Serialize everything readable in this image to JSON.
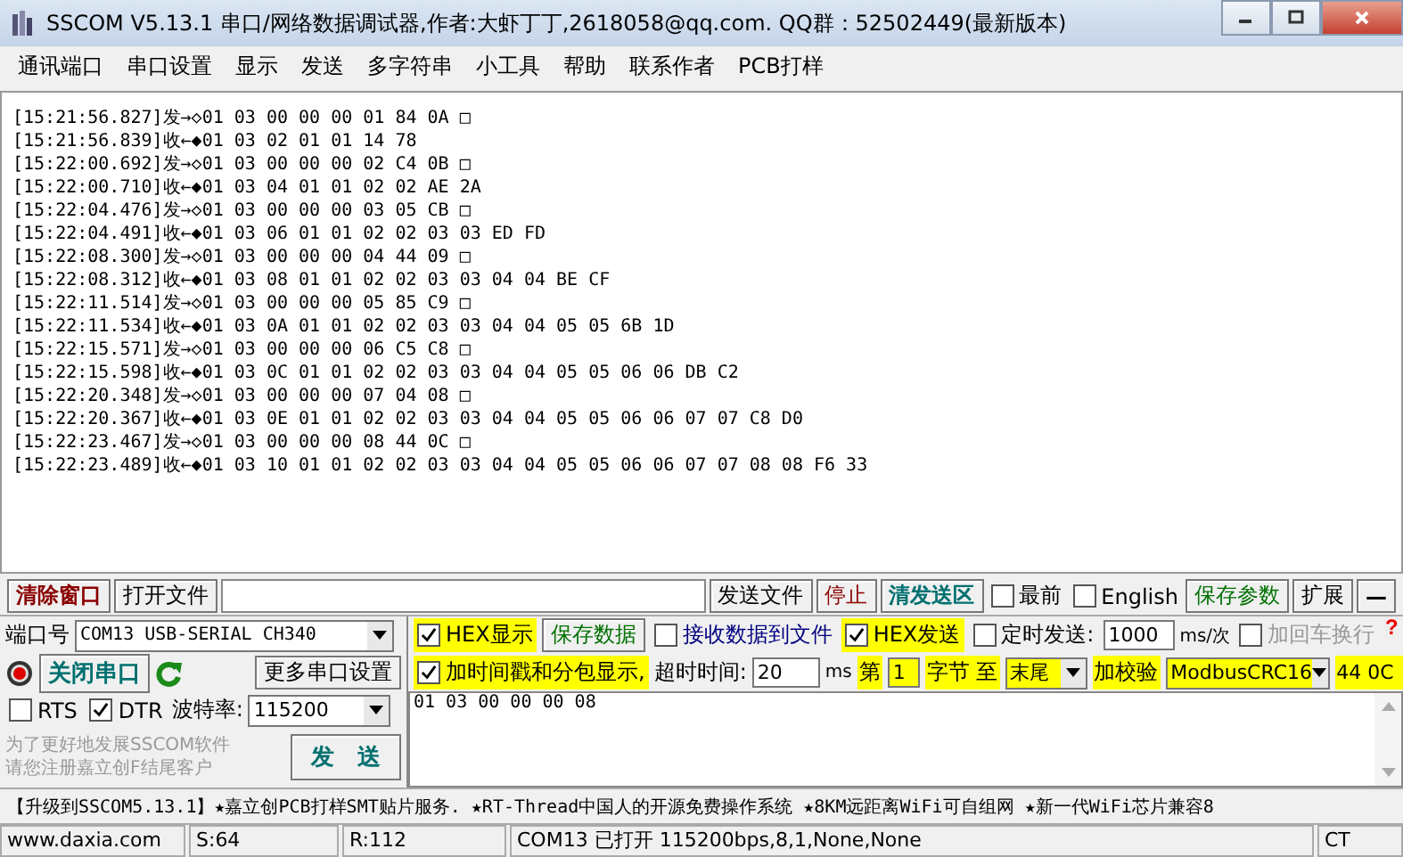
{
  "window": {
    "title": "SSCOM V5.13.1 串口/网络数据调试器,作者:大虾丁丁,2618058@qq.com. QQ群：52502449(最新版本)"
  },
  "menu": [
    "通讯端口",
    "串口设置",
    "显示",
    "发送",
    "多字符串",
    "小工具",
    "帮助",
    "联系作者",
    "PCB打样"
  ],
  "log": [
    "[15:21:56.827]发→◇01 03 00 00 00 01 84 0A □",
    "[15:21:56.839]收←◆01 03 02 01 01 14 78",
    "[15:22:00.692]发→◇01 03 00 00 00 02 C4 0B □",
    "[15:22:00.710]收←◆01 03 04 01 01 02 02 AE 2A",
    "[15:22:04.476]发→◇01 03 00 00 00 03 05 CB □",
    "[15:22:04.491]收←◆01 03 06 01 01 02 02 03 03 ED FD",
    "[15:22:08.300]发→◇01 03 00 00 00 04 44 09 □",
    "[15:22:08.312]收←◆01 03 08 01 01 02 02 03 03 04 04 BE CF",
    "[15:22:11.514]发→◇01 03 00 00 00 05 85 C9 □",
    "[15:22:11.534]收←◆01 03 0A 01 01 02 02 03 03 04 04 05 05 6B 1D",
    "[15:22:15.571]发→◇01 03 00 00 00 06 C5 C8 □",
    "[15:22:15.598]收←◆01 03 0C 01 01 02 02 03 03 04 04 05 05 06 06 DB C2",
    "[15:22:20.348]发→◇01 03 00 00 00 07 04 08 □",
    "[15:22:20.367]收←◆01 03 0E 01 01 02 02 03 03 04 04 05 05 06 06 07 07 C8 D0",
    "[15:22:23.467]发→◇01 03 00 00 00 08 44 0C □",
    "[15:22:23.489]收←◆01 03 10 01 01 02 02 03 03 04 04 05 05 06 06 07 07 08 08 F6 33"
  ],
  "toolbar": {
    "clear_button": "清除窗口",
    "open_file_button": "打开文件",
    "send_file_button": "发送文件",
    "stop_button": "停止",
    "clear_send_button": "清发送区",
    "topmost": {
      "label": "最前",
      "checked": false
    },
    "english": {
      "label": "English",
      "checked": false
    },
    "save_params_button": "保存参数",
    "expand_button": "扩展",
    "collapse_button": "—"
  },
  "port_panel": {
    "port_label": "端口号",
    "port_value": "COM13 USB-SERIAL CH340",
    "close_port_button": "关闭串口",
    "more_settings_button": "更多串口设置",
    "rts": {
      "label": "RTS",
      "checked": false
    },
    "dtr": {
      "label": "DTR",
      "checked": true
    },
    "baud_label": "波特率:",
    "baud_value": "115200",
    "promo_lines": [
      "为了更好地发展SSCOM软件",
      "请您注册嘉立创F结尾客户"
    ],
    "send_button": "发　送"
  },
  "options": {
    "hex_display": {
      "label": "HEX显示",
      "checked": true
    },
    "save_data_button": "保存数据",
    "recv_to_file": {
      "label": "接收数据到文件",
      "checked": false
    },
    "hex_send": {
      "label": "HEX发送",
      "checked": true
    },
    "timed_send": {
      "label": "定时发送:",
      "checked": false
    },
    "interval": "1000",
    "interval_unit": "ms/次",
    "add_crlf": {
      "label": "加回车换行",
      "checked": false,
      "disabled": true
    },
    "timestamp": {
      "label": "加时间戳和分包显示,",
      "checked": true
    },
    "timeout_label": "超时时间:",
    "timeout_value": "20",
    "timeout_unit": "ms",
    "byte_from_label": "第",
    "byte_from": "1",
    "byte_to_label": "字节 至",
    "byte_to": "末尾",
    "checksum_label": "加校验",
    "checksum_type": "ModbusCRC16",
    "checksum_value": "44 0C",
    "help_button": "?"
  },
  "send_text": "01 03 00 00 00 08",
  "ticker": "【升级到SSCOM5.13.1】★嘉立创PCB打样SMT贴片服务. ★RT-Thread中国人的开源免费操作系统 ★8KM远距离WiFi可自组网 ★新一代WiFi芯片兼容8",
  "status_bar": [
    "www.daxia.com",
    "S:64",
    "R:112",
    "COM13 已打开  115200bps,8,1,None,None",
    "CT"
  ]
}
